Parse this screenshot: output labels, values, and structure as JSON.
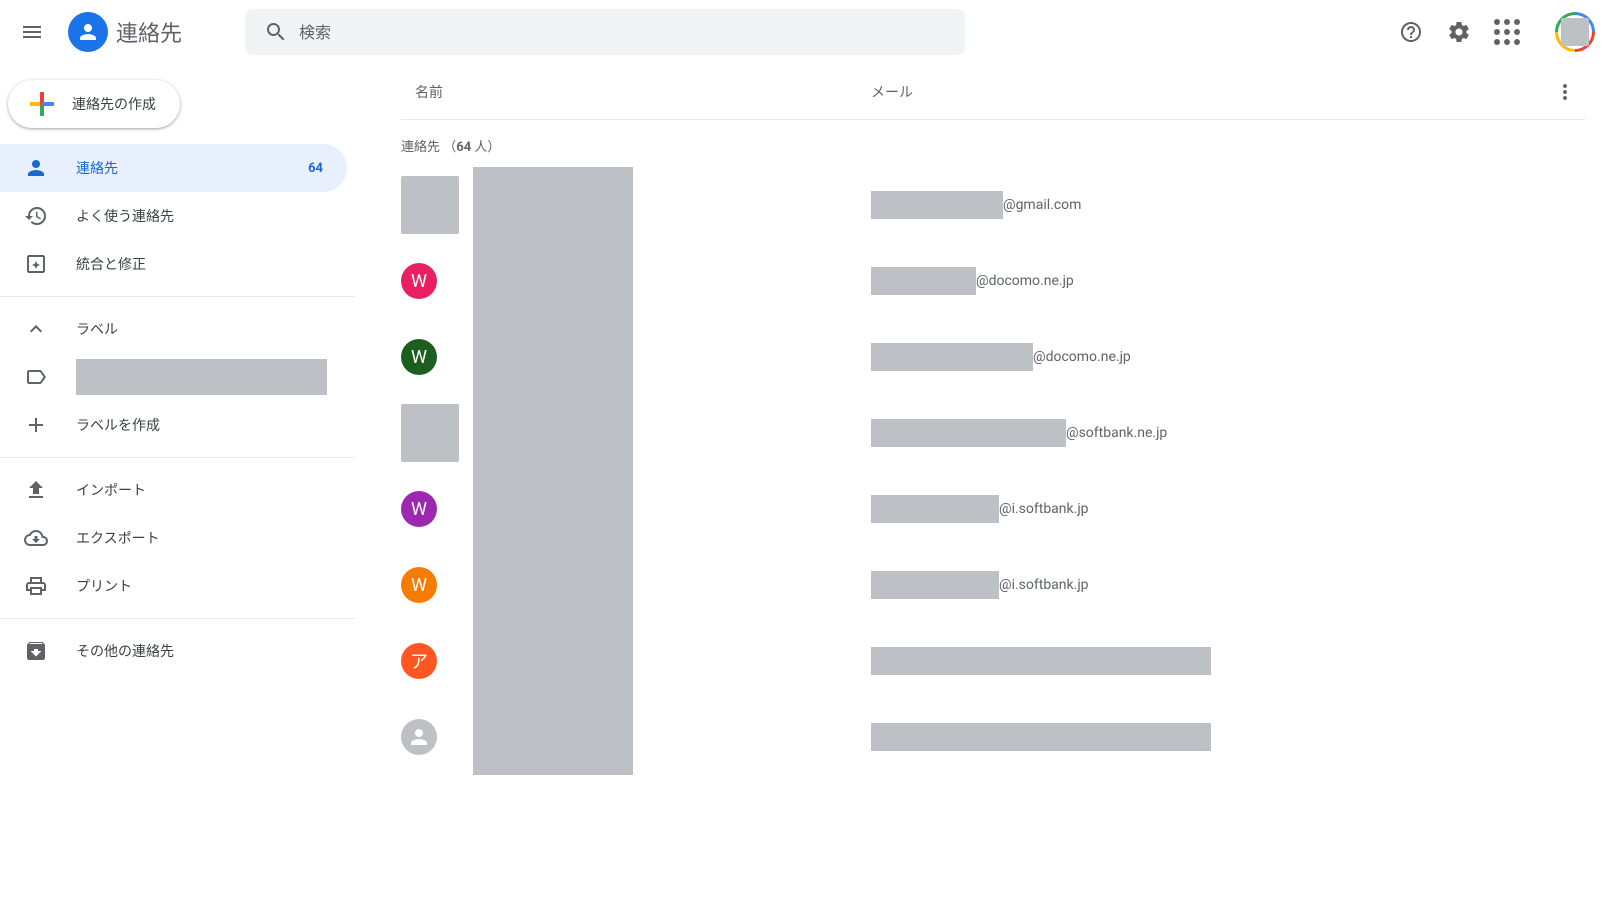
{
  "app": {
    "title": "連絡先"
  },
  "search": {
    "placeholder": "検索"
  },
  "sidebar": {
    "create_label": "連絡先の作成",
    "items": [
      {
        "label": "連絡先",
        "count": "64"
      },
      {
        "label": "よく使う連絡先"
      },
      {
        "label": "統合と修正"
      }
    ],
    "labels_header": "ラベル",
    "create_label_text": "ラベルを作成",
    "import": "インポート",
    "export": "エクスポート",
    "print": "プリント",
    "other": "その他の連絡先"
  },
  "list": {
    "col_name": "名前",
    "col_email": "メール",
    "section_prefix": "連絡先 （",
    "section_count": "64",
    "section_suffix": " 人）",
    "rows": [
      {
        "avatar_type": "square",
        "avatar_letter": "",
        "email_suffix": "@gmail.com",
        "redact_w": 132
      },
      {
        "avatar_type": "pink",
        "avatar_letter": "W",
        "email_suffix": "@docomo.ne.jp",
        "redact_w": 105
      },
      {
        "avatar_type": "darkgreen",
        "avatar_letter": "W",
        "email_suffix": "@docomo.ne.jp",
        "redact_w": 162
      },
      {
        "avatar_type": "square",
        "avatar_letter": "",
        "email_suffix": "@softbank.ne.jp",
        "redact_w": 195
      },
      {
        "avatar_type": "purple",
        "avatar_letter": "W",
        "email_suffix": "@i.softbank.jp",
        "redact_w": 128
      },
      {
        "avatar_type": "orange",
        "avatar_letter": "W",
        "email_suffix": "@i.softbank.jp",
        "redact_w": 128
      },
      {
        "avatar_type": "orangered",
        "avatar_letter": "ア",
        "email_suffix": "",
        "redact_w": 340
      },
      {
        "avatar_type": "grayperson",
        "avatar_letter": "",
        "email_suffix": "",
        "redact_w": 340
      }
    ]
  }
}
